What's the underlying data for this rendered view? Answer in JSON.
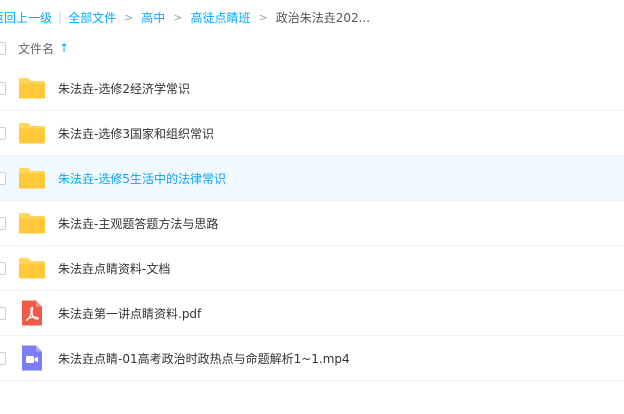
{
  "breadcrumb": {
    "back": "返回上一级",
    "all_files": "全部文件",
    "crumbs": [
      "高中",
      "高徒点睛班"
    ],
    "current": "政治朱法垚202..."
  },
  "list_header": {
    "name_label": "文件名",
    "sort_arrow": "↑"
  },
  "files": [
    {
      "name": "朱法垚-选修2经济学常识",
      "type": "folder"
    },
    {
      "name": "朱法垚-选修3国家和组织常识",
      "type": "folder"
    },
    {
      "name": "朱法垚-选修5生活中的法律常识",
      "type": "folder",
      "selected": true
    },
    {
      "name": "朱法垚-主观题答题方法与思路",
      "type": "folder"
    },
    {
      "name": "朱法垚点睛资料-文档",
      "type": "folder"
    },
    {
      "name": "朱法垚第一讲点睛资料.pdf",
      "type": "pdf"
    },
    {
      "name": "朱法垚点睛-01高考政治时政热点与命题解析1~1.mp4",
      "type": "video"
    }
  ],
  "colors": {
    "accent": "#06a7ff",
    "folder": "#ffd659",
    "pdf": "#f25b4a",
    "video": "#7b7ef5"
  }
}
